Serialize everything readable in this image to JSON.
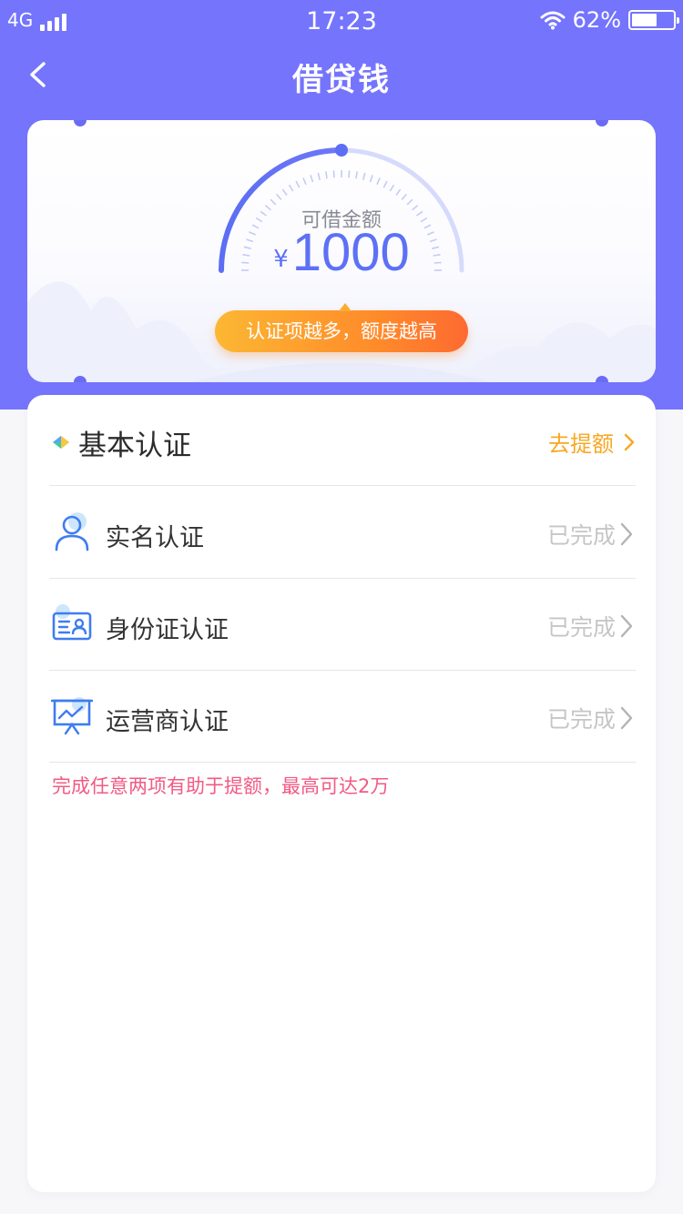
{
  "status_bar": {
    "network": "4G",
    "time": "17:23",
    "battery_text": "62%",
    "battery_level": 0.62
  },
  "nav": {
    "title": "借贷钱",
    "back_icon": "chevron-left-icon"
  },
  "quota": {
    "label": "可借金额",
    "currency": "¥",
    "amount": "1000",
    "progress": 0.5,
    "tip": "认证项越多，额度越高"
  },
  "section": {
    "title": "基本认证",
    "action": "去提额"
  },
  "items": [
    {
      "label": "实名认证",
      "status": "已完成",
      "icon": "person-icon"
    },
    {
      "label": "身份证认证",
      "status": "已完成",
      "icon": "id-card-icon"
    },
    {
      "label": "运营商认证",
      "status": "已完成",
      "icon": "chart-board-icon"
    }
  ],
  "hint": "完成任意两项有助于提额，最高可达2万",
  "colors": {
    "brand": "#7574fd",
    "accent_blue": "#5d71f5",
    "action_orange": "#f7a823",
    "hint_pink": "#f25a84",
    "done_gray": "#c6c6c6"
  }
}
